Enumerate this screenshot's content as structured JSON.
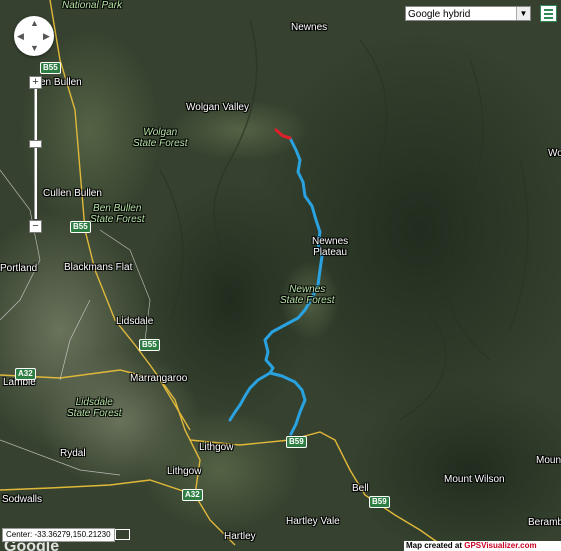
{
  "map": {
    "type_select": {
      "value": "Google hybrid"
    },
    "coordinates": "Center: -33.36279,150.21230",
    "credit_prefix": "Map created at ",
    "credit_link": "GPSVisualizer.com",
    "logo": "Google"
  },
  "labels": {
    "national_park": "National Park",
    "newnes": "Newnes",
    "ben_bullen": "en Bullen",
    "wolgan_valley": "Wolgan Valley",
    "wolgan_sf": "Wolgan\nState Forest",
    "cullen_bullen": "Cullen Bullen",
    "ben_bullen_sf": "Ben Bullen\nState Forest",
    "wo": "Wo",
    "newnes_plateau": "Newnes\nPlateau",
    "newnes_sf": "Newnes\nState Forest",
    "portland": "Portland",
    "blackmans_flat": "Blackmans Flat",
    "lidsdale": "Lidsdale",
    "marrangaroo": "Marrangaroo",
    "lambie": "Lambie",
    "lidsdale_sf": "Lidsdale\nState Forest",
    "lithgow1": "Lithgow",
    "lithgow2": "Lithgow",
    "rydal": "Rydal",
    "bell": "Bell",
    "mount_wilson": "Mount Wilson",
    "mount_w": "Moun W",
    "sodwalls": "Sodwalls",
    "hartley": "Hartley",
    "hartley_vale": "Hartley Vale",
    "berambi": "Berambi"
  },
  "shields": {
    "b55_a": "B55",
    "b55_b": "B55",
    "b55_c": "B55",
    "a32_a": "A32",
    "a32_b": "A32",
    "b59_a": "B59",
    "b59_b": "B59"
  },
  "colors": {
    "track": "#2aa2e0",
    "track_start": "#e0202a",
    "road": "#e0b83a"
  }
}
